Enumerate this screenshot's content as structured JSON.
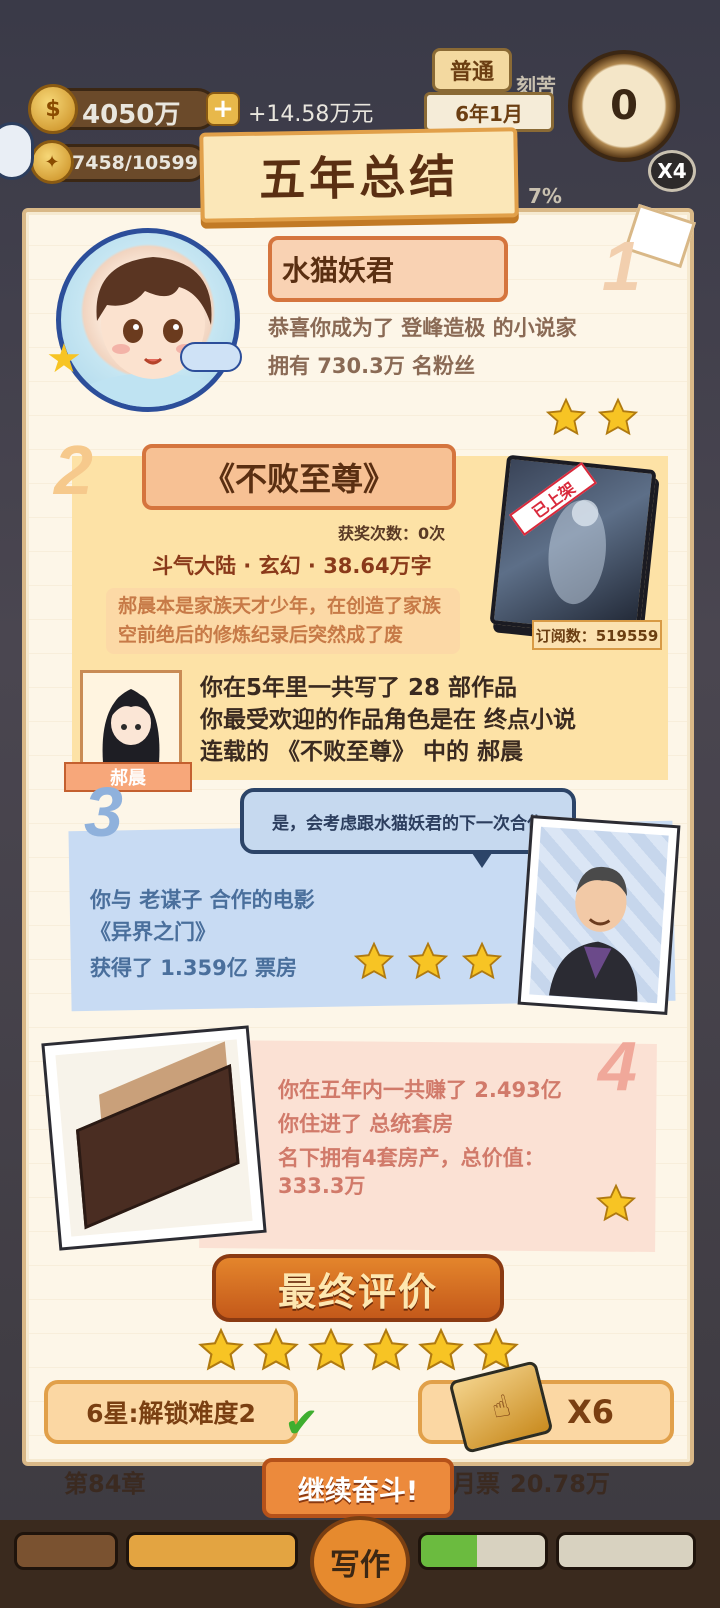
{
  "hud": {
    "money": "4050万",
    "income": "+14.58万元",
    "fans": "7458/10599",
    "difficulty": "普通",
    "peek_label": "刻苦",
    "date": "6年1月",
    "timer": "0",
    "speed": "X4",
    "percent": "7%"
  },
  "summary": {
    "title": "五年总结",
    "section1": {
      "number": "1",
      "author_name": "水猫妖君",
      "line1": "恭喜你成为了  登峰造极  的小说家",
      "line2": "拥有  730.3万  名粉丝",
      "stars": 2
    },
    "section2": {
      "number": "2",
      "book_title": "《不败至尊》",
      "awards": "获奖次数：0次",
      "genre_words": "斗气大陆 · 玄幻 · 38.64万字",
      "description": "郝晨本是家族天才少年，在创造了家族空前绝后的修炼纪录后突然成了废",
      "shelf_badge": "已上架",
      "subscriptions": "订阅数：519559",
      "character_name": "郝晨",
      "line1": "你在5年里一共写了  28  部作品",
      "line2": "你最受欢迎的作品角色是在  终点小说",
      "line3": "连载的  《不败至尊》  中的  郝晨"
    },
    "section3": {
      "number": "3",
      "speech": "是，会考虑跟水猫妖君的下一次合作",
      "line1": "你与  老谋子  合作的电影",
      "line2": "《异界之门》",
      "line3": "获得了  1.359亿  票房",
      "stars": 3
    },
    "section4": {
      "number": "4",
      "line1": "你在五年内一共赚了  2.493亿",
      "line2": "你住进了  总统套房",
      "line3": "名下拥有4套房产，总价值：",
      "line4": "333.3万",
      "stars": 1
    },
    "final": {
      "label": "最终评价",
      "stars": 6,
      "unlock_label": "6星:解锁难度2",
      "multiplier": "X6",
      "continue_label": "继续奋斗!"
    }
  },
  "background": {
    "chapter": "第84章",
    "ticket_label": "月票",
    "ticket_value": "20.78万",
    "write_label": "写作"
  },
  "colors": {
    "star_fill": "#f7c424",
    "panel_bg": "#fdf6e8",
    "accent_orange": "#d5753e"
  }
}
